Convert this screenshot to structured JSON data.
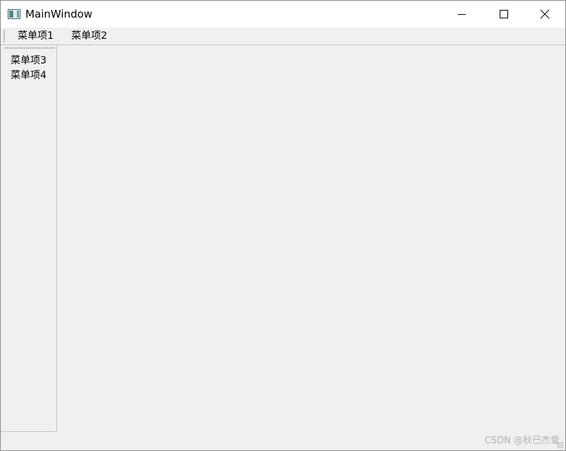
{
  "window": {
    "title": "MainWindow",
    "icon": "qt-window-icon"
  },
  "title_buttons": {
    "minimize": "minimize-icon",
    "maximize": "maximize-icon",
    "close": "close-icon"
  },
  "toolbar": {
    "items": [
      {
        "label": "菜单项1"
      },
      {
        "label": "菜单项2"
      }
    ]
  },
  "side_toolbar": {
    "items": [
      {
        "label": "菜单项3"
      },
      {
        "label": "菜单项4"
      }
    ]
  },
  "watermark": {
    "text": "CSDN @秋已杰爱"
  }
}
